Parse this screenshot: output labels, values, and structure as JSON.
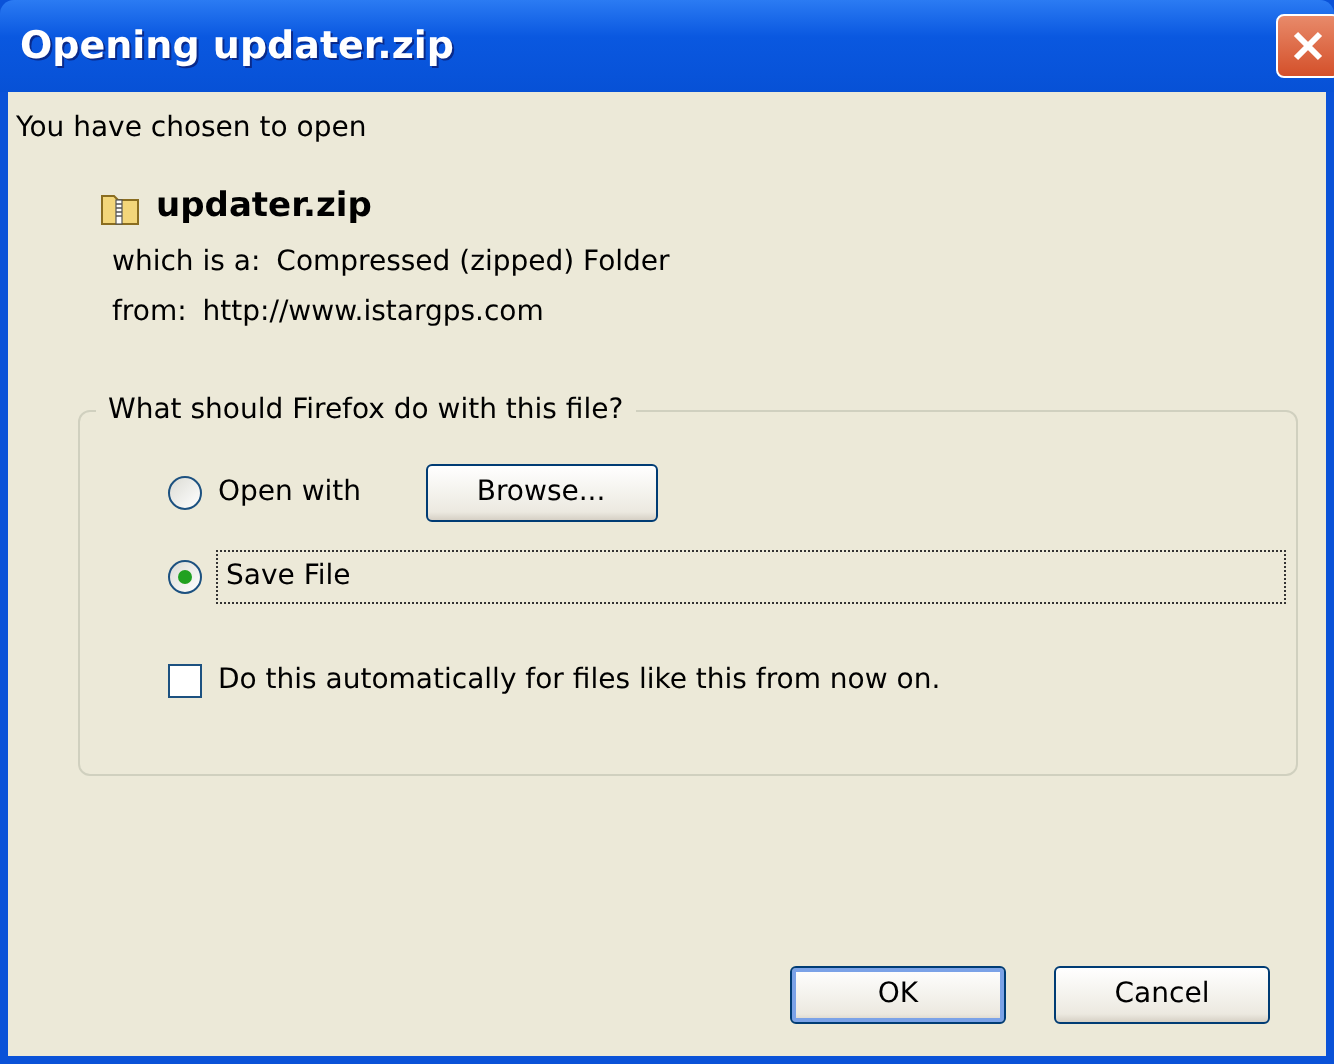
{
  "window": {
    "title": "Opening updater.zip"
  },
  "intro": "You have chosen to open",
  "file": {
    "name": "updater.zip",
    "details": [
      {
        "label": "which is a:",
        "value": "Compressed (zipped) Folder"
      },
      {
        "label": "from:",
        "value": "http://www.istargps.com"
      }
    ]
  },
  "action_group": {
    "legend": "What should Firefox do with this file?",
    "options": [
      {
        "label": "Open with",
        "selected": false,
        "button": "Browse..."
      },
      {
        "label": "Save File",
        "selected": true
      }
    ],
    "remember": {
      "label": "Do this automatically for files like this from now on.",
      "checked": false
    }
  },
  "buttons": [
    {
      "label": "OK",
      "default": true
    },
    {
      "label": "Cancel",
      "default": false
    }
  ]
}
